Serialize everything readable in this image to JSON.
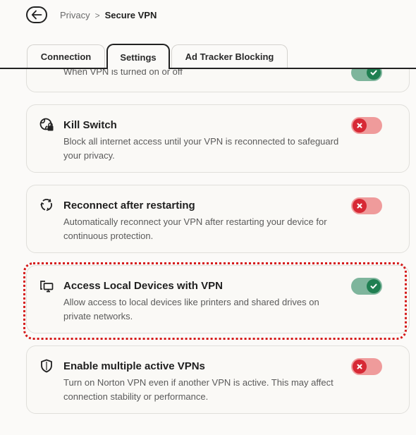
{
  "breadcrumb": {
    "parent": "Privacy",
    "separator": ">",
    "current": "Secure VPN"
  },
  "tabs": [
    {
      "label": "Connection"
    },
    {
      "label": "Settings",
      "selected": true
    },
    {
      "label": "Ad Tracker Blocking"
    }
  ],
  "cards": [
    {
      "title": "",
      "description": "When VPN is turned on or off",
      "toggle": "on"
    },
    {
      "title": "Kill Switch",
      "description": "Block all internet access until your VPN is reconnected to safeguard your privacy.",
      "icon": "globe-lock-icon",
      "toggle": "off"
    },
    {
      "title": "Reconnect after restarting",
      "description": "Automatically reconnect your VPN after restarting your device for continuous protection.",
      "icon": "reconnect-icon",
      "toggle": "off"
    },
    {
      "title": "Access Local Devices with VPN",
      "description": "Allow access to local devices like printers and shared drives on private networks.",
      "icon": "local-devices-icon",
      "toggle": "on"
    },
    {
      "title": "Enable multiple active VPNs",
      "description": "Turn on Norton VPN even if another VPN is active. This may affect connection stability or performance.",
      "icon": "shield-icon",
      "toggle": "off"
    }
  ],
  "colors": {
    "toggle_on": "#7eb59c",
    "toggle_on_knob": "#1f7f51",
    "toggle_off": "#ef9b9b",
    "toggle_off_knob": "#d72935",
    "highlight": "#d51a1a"
  }
}
